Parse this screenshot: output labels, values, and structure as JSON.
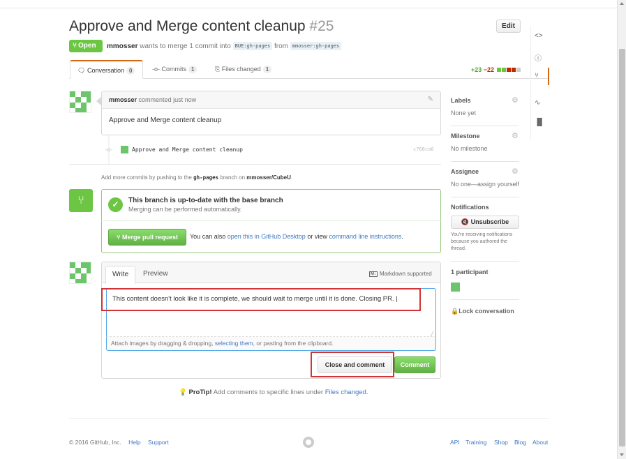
{
  "pr": {
    "title": "Approve and Merge content cleanup",
    "number": "#25",
    "edit_label": "Edit",
    "state": "Open",
    "author": "mmosser",
    "meta_text": "wants to merge 1 commit into",
    "base_branch": "BUE:gh-pages",
    "from_text": "from",
    "head_branch": "mmosser:gh-pages"
  },
  "tabs": [
    {
      "label": "Conversation",
      "count": "0"
    },
    {
      "label": "Commits",
      "count": "1"
    },
    {
      "label": "Files changed",
      "count": "1"
    }
  ],
  "diffstat": {
    "additions": "+23",
    "deletions": "−22"
  },
  "comment": {
    "author": "mmosser",
    "time_text": "commented just now",
    "body": "Approve and Merge content cleanup"
  },
  "commit": {
    "message": "Approve and Merge content cleanup",
    "sha": "c766ca6"
  },
  "add_more": {
    "prefix": "Add more commits by pushing to the",
    "branch": "gh-pages",
    "middle": "branch on",
    "repo": "mmosser/CubeU",
    "suffix": "."
  },
  "merge": {
    "title": "This branch is up-to-date with the base branch",
    "subtitle": "Merging can be performed automatically.",
    "button": "Merge pull request",
    "alt_prefix": "You can also",
    "alt_link1": "open this in GitHub Desktop",
    "alt_mid": "or view",
    "alt_link2": "command line instructions",
    "alt_suffix": "."
  },
  "editor": {
    "tab_write": "Write",
    "tab_preview": "Preview",
    "markdown": "Markdown supported",
    "markdown_badge": "M↓",
    "text": "This content doesn't look like it is complete, we should wait to merge until it is done.  Closing PR. |",
    "attach_prefix": "Attach images by dragging & dropping,",
    "attach_link": "selecting them",
    "attach_suffix": ", or pasting from the clipboard.",
    "close_button": "Close and comment",
    "comment_button": "Comment"
  },
  "protip": {
    "label": "ProTip!",
    "text": "Add comments to specific lines under",
    "link": "Files changed",
    "suffix": "."
  },
  "sidebar": {
    "labels_title": "Labels",
    "labels_value": "None yet",
    "milestone_title": "Milestone",
    "milestone_value": "No milestone",
    "assignee_title": "Assignee",
    "assignee_value": "No one—assign yourself",
    "notifications_title": "Notifications",
    "unsubscribe": "Unsubscribe",
    "notifications_text": "You're receiving notifications because you authored the thread.",
    "participants": "1 participant",
    "lock": "Lock conversation"
  },
  "footer": {
    "copyright": "© 2016 GitHub, Inc.",
    "left_links": [
      "Help",
      "Support"
    ],
    "right_links": [
      "API",
      "Training",
      "Shop",
      "Blog",
      "About"
    ]
  },
  "colors": {
    "accent_green": "#6cc644",
    "link_blue": "#4078c0",
    "highlight_red": "#d03434",
    "tab_orange": "#d26911"
  }
}
